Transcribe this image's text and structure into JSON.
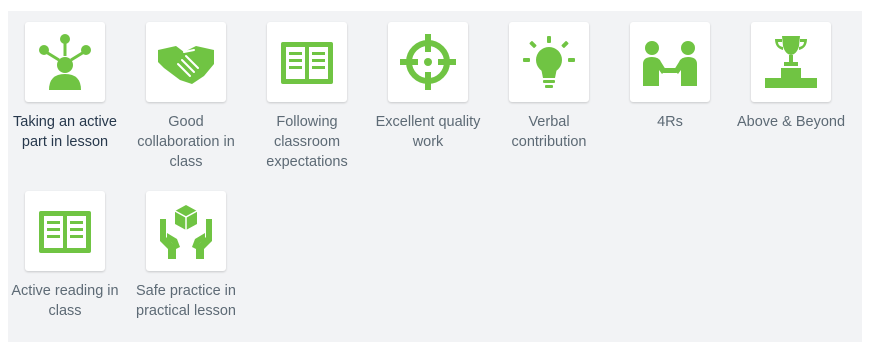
{
  "colors": {
    "icon": "#70c443",
    "label": "#5d6a75",
    "label_selected": "#27384c",
    "panel": "#f2f3f5"
  },
  "awards": [
    {
      "label": "Taking an active part in lesson",
      "icon": "person-network-icon",
      "selected": true
    },
    {
      "label": "Good collaboration in class",
      "icon": "handshake-icon"
    },
    {
      "label": "Following classroom expectations",
      "icon": "open-book-icon"
    },
    {
      "label": "Excellent quality work",
      "icon": "crosshair-icon"
    },
    {
      "label": "Verbal contribution",
      "icon": "lightbulb-icon"
    },
    {
      "label": "4Rs",
      "icon": "two-people-handshake-icon"
    },
    {
      "label": "Above & Beyond",
      "icon": "trophy-podium-icon"
    },
    {
      "label": "Active reading in class",
      "icon": "open-book-icon"
    },
    {
      "label": "Safe practice in practical lesson",
      "icon": "hands-holding-box-icon"
    }
  ]
}
